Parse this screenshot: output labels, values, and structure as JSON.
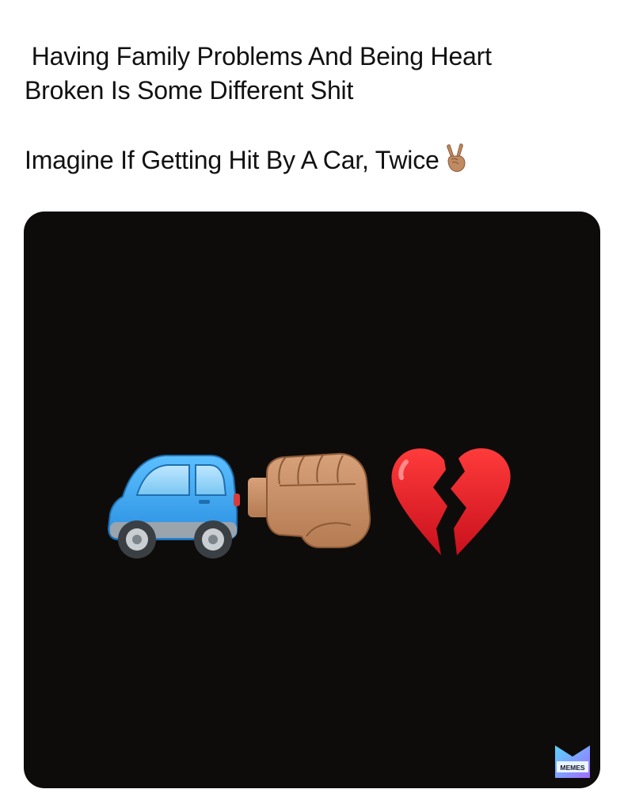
{
  "caption": {
    "line1": " Having Family Problems And Being Heart",
    "line2": "Broken Is Some Different Shit",
    "line3": "Imagine If Getting Hit By A Car, Twice"
  },
  "emoji_sequence": [
    "car-icon",
    "fist-icon",
    "broken-heart-icon"
  ],
  "caption_emoji": "victory-hand-icon",
  "watermark": {
    "text": "MEMES"
  },
  "colors": {
    "image_background": "#0e0c0b",
    "car_body": "#3fa9f5",
    "heart": "#e8232c",
    "skin": "#c08a62"
  }
}
